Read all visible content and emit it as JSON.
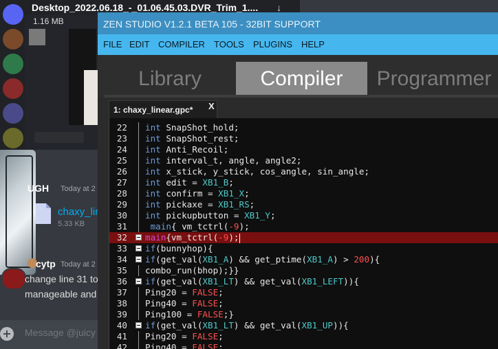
{
  "discord": {
    "download_name": "Desktop_2022.06.18_-_01.06.45.03.DVR_Trim_1....",
    "download_size": "1.16 MB",
    "user1": "UGH",
    "user1_time": "Today at 2",
    "file_name": "chaxy_lin",
    "file_size": "5.33 KB",
    "user2": "cytp",
    "user2_time": "Today at 2",
    "msg_line1": "change line 31 to",
    "msg_line2": "manageable and",
    "input_placeholder": "Message @juicy",
    "add_label": "+"
  },
  "zen": {
    "title": "ZEN STUDIO V1.2.1 BETA 105 - 32BIT SUPPORT",
    "menu": [
      "FILE",
      "EDIT",
      "COMPILER",
      "TOOLS",
      "PLUGINS",
      "HELP"
    ],
    "tabs": [
      "Library",
      "Compiler",
      "Programmer"
    ],
    "active_tab": "Compiler",
    "file_tab": "1: chaxy_linear.gpc*",
    "file_tab_close": "X",
    "highlight_line": "32",
    "code": [
      {
        "n": "22",
        "fold": false,
        "parts": [
          [
            "k",
            "int"
          ],
          [
            "s",
            " SnapShot_hold;"
          ]
        ]
      },
      {
        "n": "23",
        "fold": false,
        "parts": [
          [
            "k",
            "int"
          ],
          [
            "s",
            " SnapShot_rest;"
          ]
        ]
      },
      {
        "n": "24",
        "fold": false,
        "parts": [
          [
            "k",
            "int"
          ],
          [
            "s",
            " Anti_Recoil;"
          ]
        ]
      },
      {
        "n": "25",
        "fold": false,
        "parts": [
          [
            "k",
            "int"
          ],
          [
            "s",
            " interval_t, angle, angle2;"
          ]
        ]
      },
      {
        "n": "26",
        "fold": false,
        "parts": [
          [
            "k",
            "int"
          ],
          [
            "s",
            " x_stick, y_stick, cos_angle, sin_angle;"
          ]
        ]
      },
      {
        "n": "27",
        "fold": false,
        "parts": [
          [
            "k",
            "int"
          ],
          [
            "s",
            " edit = "
          ],
          [
            "v",
            "XB1_B"
          ],
          [
            "s",
            ";"
          ]
        ]
      },
      {
        "n": "28",
        "fold": false,
        "parts": [
          [
            "k",
            "int"
          ],
          [
            "s",
            " confirm = "
          ],
          [
            "v",
            "XB1_X"
          ],
          [
            "s",
            ";"
          ]
        ]
      },
      {
        "n": "29",
        "fold": false,
        "parts": [
          [
            "k",
            "int"
          ],
          [
            "s",
            " pickaxe = "
          ],
          [
            "v",
            "XB1_RS"
          ],
          [
            "s",
            ";"
          ]
        ]
      },
      {
        "n": "30",
        "fold": false,
        "parts": [
          [
            "k",
            "int"
          ],
          [
            "s",
            " pickupbutton = "
          ],
          [
            "v",
            "XB1_Y"
          ],
          [
            "s",
            ";"
          ]
        ]
      },
      {
        "n": "31",
        "fold": false,
        "parts": [
          [
            "s",
            " "
          ],
          [
            "k",
            "main"
          ],
          [
            "s",
            "{ vm_tctrl("
          ],
          [
            "n",
            "-9"
          ],
          [
            "s",
            ");"
          ]
        ]
      },
      {
        "n": "32",
        "fold": true,
        "parts": [
          [
            "k2",
            "main"
          ],
          [
            "s",
            "{vm_tctrl("
          ],
          [
            "n",
            "-9"
          ],
          [
            "s",
            ");"
          ]
        ]
      },
      {
        "n": "33",
        "fold": true,
        "parts": [
          [
            "k",
            "if"
          ],
          [
            "s",
            "(bunnyhop){"
          ]
        ]
      },
      {
        "n": "34",
        "fold": true,
        "parts": [
          [
            "k",
            "if"
          ],
          [
            "s",
            "(get_val("
          ],
          [
            "v",
            "XB1_A"
          ],
          [
            "s",
            ") && get_ptime("
          ],
          [
            "v",
            "XB1_A"
          ],
          [
            "s",
            ") > "
          ],
          [
            "n",
            "200"
          ],
          [
            "s",
            "){"
          ]
        ]
      },
      {
        "n": "35",
        "fold": false,
        "parts": [
          [
            "s",
            "combo_run(bhop);}}"
          ]
        ]
      },
      {
        "n": "36",
        "fold": true,
        "parts": [
          [
            "k",
            "if"
          ],
          [
            "s",
            "(get_val("
          ],
          [
            "v",
            "XB1_LT"
          ],
          [
            "s",
            ") && get_val("
          ],
          [
            "v",
            "XB1_LEFT"
          ],
          [
            "s",
            ")){"
          ]
        ]
      },
      {
        "n": "37",
        "fold": false,
        "parts": [
          [
            "s",
            "Ping20 = "
          ],
          [
            "n",
            "FALSE"
          ],
          [
            "s",
            ";"
          ]
        ]
      },
      {
        "n": "38",
        "fold": false,
        "parts": [
          [
            "s",
            "Ping40 = "
          ],
          [
            "n",
            "FALSE"
          ],
          [
            "s",
            ";"
          ]
        ]
      },
      {
        "n": "39",
        "fold": false,
        "parts": [
          [
            "s",
            "Ping100 = "
          ],
          [
            "n",
            "FALSE"
          ],
          [
            "s",
            ";}"
          ]
        ]
      },
      {
        "n": "40",
        "fold": true,
        "parts": [
          [
            "k",
            "if"
          ],
          [
            "s",
            "(get_val("
          ],
          [
            "v",
            "XB1_LT"
          ],
          [
            "s",
            ") && get_val("
          ],
          [
            "v",
            "XB1_UP"
          ],
          [
            "s",
            "))"
          ],
          [
            "s",
            "{"
          ]
        ]
      },
      {
        "n": "41",
        "fold": false,
        "parts": [
          [
            "s",
            "Ping20 = "
          ],
          [
            "n",
            "FALSE"
          ],
          [
            "s",
            ";"
          ]
        ]
      },
      {
        "n": "42",
        "fold": false,
        "parts": [
          [
            "s",
            "Ping40 = "
          ],
          [
            "n",
            "FALSE"
          ],
          [
            "s",
            ";"
          ]
        ]
      }
    ]
  }
}
